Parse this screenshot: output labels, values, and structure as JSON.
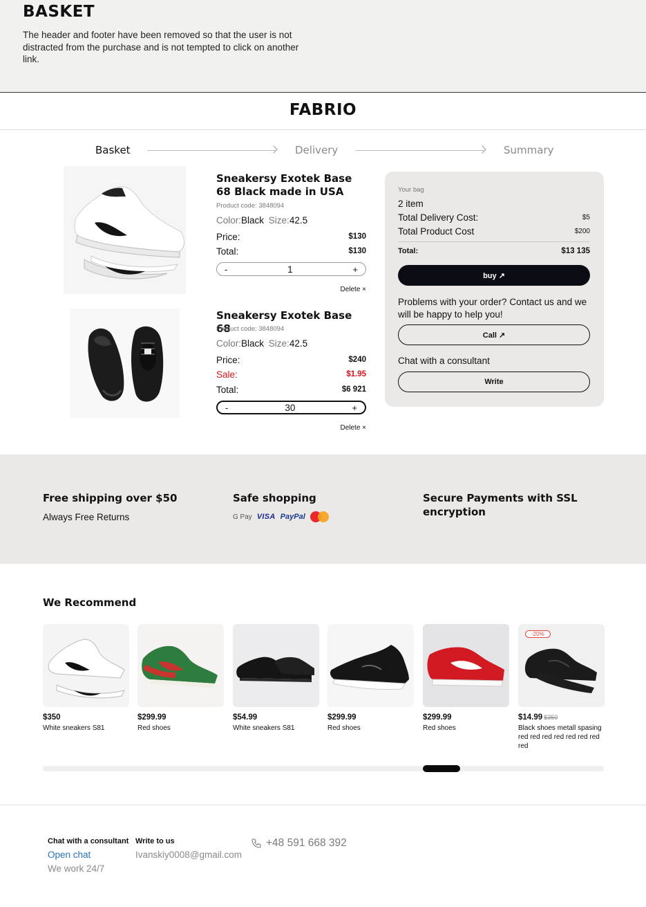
{
  "annotation": {
    "title": "BASKET",
    "note": "The header and footer have been removed so that the user is not distracted from the purchase and is not tempted to click on another link."
  },
  "brand": {
    "logo": "FABRIO"
  },
  "steps": [
    {
      "label": "Basket",
      "state": "active"
    },
    {
      "label": "Delivery",
      "state": "inactive"
    },
    {
      "label": "Summary",
      "state": "inactive"
    }
  ],
  "cart": {
    "items": [
      {
        "name": "Sneakersy Exotek Base 68 Black made in USA",
        "code": "Product code: 3848094",
        "color_label": "Color:",
        "color": "Black",
        "size_label": "Size:",
        "size": "42.5",
        "price_label": "Price:",
        "price": "$130",
        "total_label": "Total:",
        "total": "$130",
        "qty_minus": "-",
        "qty": "1",
        "qty_plus": "+",
        "delete": "Delete ×"
      },
      {
        "name": "Sneakersy Exotek Base 68",
        "code": "Product code: 3848094",
        "color_label": "Color:",
        "color": "Black",
        "size_label": "Size:",
        "size": "42.5",
        "price_label": "Price:",
        "price": "$240",
        "sale_label": "Sale:",
        "sale": "$1.95",
        "total_label": "Total:",
        "total": "$6 921",
        "qty_minus": "-",
        "qty": "30",
        "qty_plus": "+",
        "delete": "Delete ×"
      }
    ]
  },
  "summary": {
    "bag_label": "Your bag",
    "item_count": "2 item",
    "delivery_label": "Total Delivery Cost:",
    "delivery_value": "$5",
    "product_label": "Total Product Cost",
    "product_value": "$200",
    "total_label": "Total:",
    "total_value": "$13 135",
    "buy_label": "buy ↗",
    "help_text": "Problems with your order? Contact us and we will be happy to help you!",
    "call_label": "Call ↗",
    "chat_text": "Chat with a consultant",
    "write_label": "Write"
  },
  "features": {
    "shipping_title": "Free shipping over $50",
    "shipping_sub": "Always Free Returns",
    "safe_title": "Safe shopping",
    "payments_title": "Secure Payments with SSL encryption",
    "pay_methods": {
      "gpay": "G Pay",
      "visa": "VISA",
      "paypal": "PayPal"
    }
  },
  "recommend": {
    "title": "We Recommend",
    "products": [
      {
        "price": "$350",
        "title": "White sneakers S81"
      },
      {
        "price": "$299.99",
        "title": "Red shoes"
      },
      {
        "price": "$54.99",
        "title": "White sneakers S81"
      },
      {
        "price": "$299.99",
        "title": "Red shoes"
      },
      {
        "price": "$299.99",
        "title": "Red shoes"
      },
      {
        "price": "$14.99",
        "old_price": "$350",
        "badge": "-20%",
        "title": "Black shoes metall spasing red red red red red red red red"
      }
    ]
  },
  "footer": {
    "chat_heading": "Chat with a consultant",
    "chat_link": "Open chat",
    "chat_hours": "We work 24/7",
    "write_heading": "Write to us",
    "email": "Ivanskiy0008@gmail.com",
    "phone": "+48 591 668 392"
  }
}
